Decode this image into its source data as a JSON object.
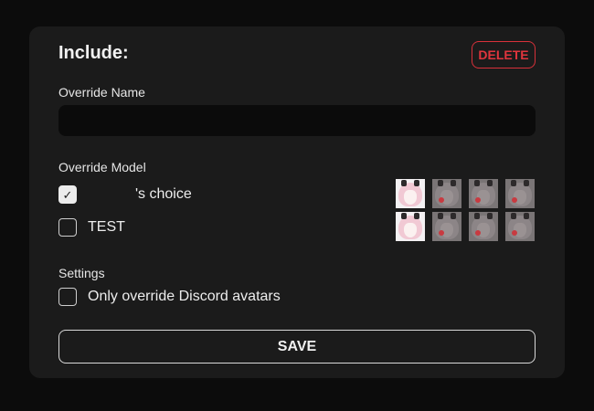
{
  "header": {
    "title": "Include:",
    "delete_label": "DELETE"
  },
  "override_name": {
    "label": "Override Name",
    "value": "",
    "placeholder": ""
  },
  "override_model": {
    "label": "Override Model",
    "options": [
      {
        "label": "'s choice",
        "checked": true
      },
      {
        "label": "TEST",
        "checked": false
      }
    ]
  },
  "settings": {
    "label": "Settings",
    "options": [
      {
        "label": "Only override Discord avatars",
        "checked": false
      }
    ]
  },
  "save_label": "SAVE",
  "colors": {
    "background": "#0c0c0c",
    "card": "#1b1b1b",
    "danger": "#e0353d",
    "input": "#0b0b0b"
  },
  "icons": {
    "checkbox_checked": "check-icon",
    "model_thumbnail": "avatar-thumbnail-icon"
  }
}
